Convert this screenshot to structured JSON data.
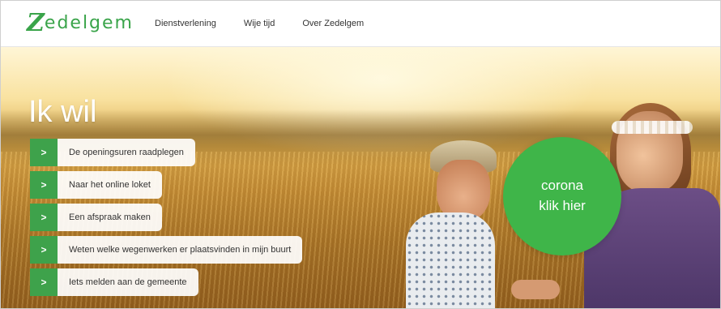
{
  "header": {
    "logo": {
      "letter": "Z",
      "text": "edelgem",
      "color": "#3aa44a"
    },
    "nav": [
      {
        "label": "Dienstverlening"
      },
      {
        "label": "Wije tijd"
      },
      {
        "label": "Over Zedelgem"
      }
    ]
  },
  "hero": {
    "title": "Ik wil",
    "quick_links": [
      {
        "label": "De openingsuren raadplegen",
        "icon": "chevron-right-icon"
      },
      {
        "label": "Naar het online loket",
        "icon": "chevron-right-icon"
      },
      {
        "label": "Een afspraak maken",
        "icon": "chevron-right-icon"
      },
      {
        "label": "Weten welke wegenwerken er plaatsvinden in mijn buurt",
        "icon": "chevron-right-icon"
      },
      {
        "label": "Iets melden aan de gemeente",
        "icon": "chevron-right-icon"
      }
    ],
    "chevron_glyph": ">",
    "corona_button": {
      "line1": "corona",
      "line2": "klik hier",
      "color": "#3fb549"
    },
    "accent_color": "#3ea24b"
  }
}
